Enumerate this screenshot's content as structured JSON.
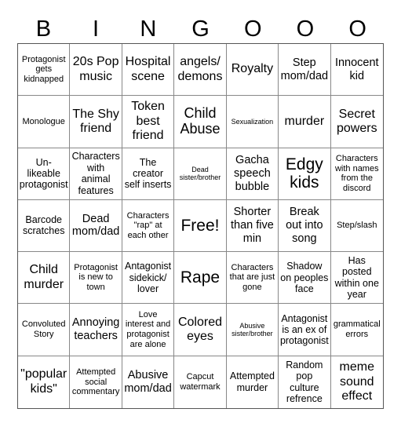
{
  "header": [
    "B",
    "I",
    "N",
    "G",
    "O",
    "O",
    "O"
  ],
  "cells": [
    [
      "Protagonist gets kidnapped",
      "20s Pop music",
      "Hospital scene",
      "angels/ demons",
      "Royalty",
      "Step mom/dad",
      "Innocent kid"
    ],
    [
      "Monologue",
      "The Shy friend",
      "Token best friend",
      "Child Abuse",
      "Sexualization",
      "murder",
      "Secret powers"
    ],
    [
      "Un- likeable protagonist",
      "Characters with animal features",
      "The creator self inserts",
      "Dead sister/brother",
      "Gacha speech bubble",
      "Edgy kids",
      "Characters with names from the discord"
    ],
    [
      "Barcode scratches",
      "Dead mom/dad",
      "Characters \"rap\" at each other",
      "Free!",
      "Shorter than five min",
      "Break out into song",
      "Step/slash"
    ],
    [
      "Child murder",
      "Protagonist is new to town",
      "Antagonist sidekick/ lover",
      "Rape",
      "Characters that are just gone",
      "Shadow on peoples face",
      "Has posted within one year"
    ],
    [
      "Convoluted Story",
      "Annoying teachers",
      "Love interest and protagonist are alone",
      "Colored eyes",
      "Abusive sister/brother",
      "Antagonist is an ex of protagonist",
      "grammatical errors"
    ],
    [
      "\"popular kids\"",
      "Attempted social commentary",
      "Abusive mom/dad",
      "Capcut watermark",
      "Attempted murder",
      "Random pop culture refrence",
      "meme sound effect"
    ]
  ]
}
